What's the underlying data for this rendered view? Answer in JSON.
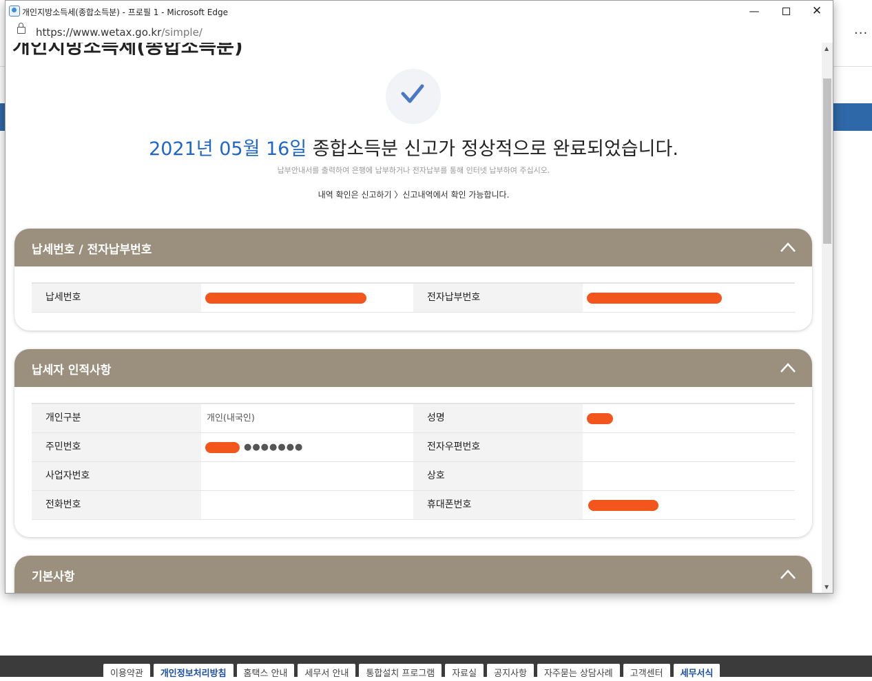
{
  "window": {
    "title": "개인지방소득세(종합소득분) - 프로필 1 - Microsoft Edge",
    "url_base": "https://www.wetax.go.kr",
    "url_path": "/simple/",
    "min_symbol": "—",
    "close_symbol": "✕"
  },
  "page": {
    "cut_heading": "개인지방소득세(종합소득분)",
    "headline_date": "2021년 05월 16일",
    "headline_rest": " 종합소득분 신고가 정상적으로 완료되었습니다.",
    "notice": "납부안내서를 출력하여 은행에 납부하거나 전자납부를 통해 인터넷 납부하여 주십시오.",
    "history_notice": "내역 확인은 신고하기 〉신고내역에서 확인 가능합니다."
  },
  "sections": {
    "tax_number": {
      "title": "납세번호 / 전자납부번호",
      "label_tax_no": "납세번호",
      "label_epay_no": "전자납부번호"
    },
    "taxpayer": {
      "title": "납세자 인적사항",
      "label_type": "개인구분",
      "value_type": "개인(내국인)",
      "label_name": "성명",
      "label_rrn": "주민번호",
      "value_rrn_masked": "●●●●●●●",
      "label_epost": "전자우편번호",
      "label_bizno": "사업자번호",
      "label_company": "상호",
      "label_phone": "전화번호",
      "label_mobile": "휴대폰번호"
    },
    "basic": {
      "title": "기본사항"
    }
  },
  "background": {
    "footer_links": [
      "이용약관",
      "개인정보처리방침",
      "홈택스 안내",
      "세무서 안내",
      "통합설치 프로그램",
      "자료실",
      "공지사항",
      "자주묻는 상담사례",
      "고객센터",
      "세무서식"
    ],
    "menu_dots": "···"
  },
  "colors": {
    "accent_blue": "#1f66c7",
    "section_header": "#9b8f7d",
    "redaction": "#f2561d",
    "bg_blue_bar": "#2f68a8"
  }
}
